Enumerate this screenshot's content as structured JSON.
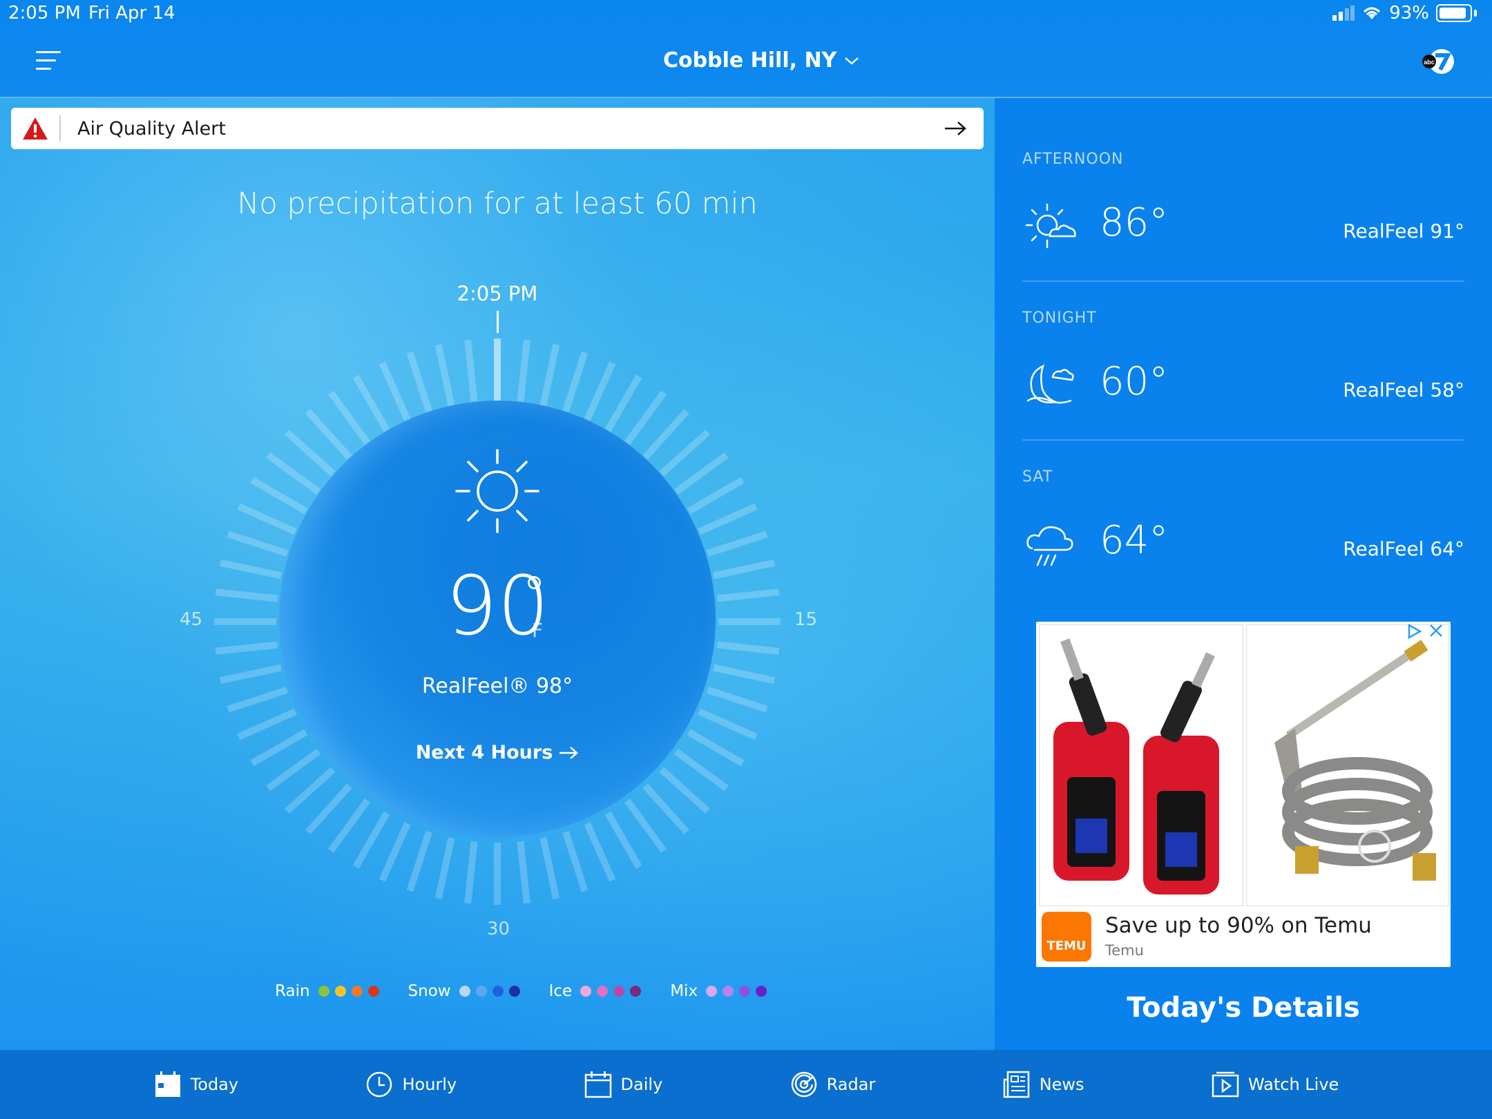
{
  "status_bar": {
    "time": "2:05 PM",
    "date": "Fri Apr 14",
    "battery": "93%"
  },
  "header": {
    "location": "Cobble Hill, NY"
  },
  "alert": {
    "text": "Air Quality Alert"
  },
  "minutecast": {
    "summary": "No precipitation for at least 60 min",
    "time": "2:05 PM",
    "dial_labels": {
      "left": "45",
      "right": "15",
      "bottom": "30"
    }
  },
  "current": {
    "temperature": "90",
    "degree": "°",
    "unit": "F",
    "realfeel": "RealFeel® 98°",
    "next_hours": "Next 4 Hours",
    "icon": "sun-icon"
  },
  "legend": [
    {
      "label": "Rain",
      "colors": [
        "#8ac43f",
        "#f2c62b",
        "#f07a2a",
        "#d9361e"
      ]
    },
    {
      "label": "Snow",
      "colors": [
        "#b8d8f5",
        "#5aa8f0",
        "#2060e0",
        "#1a2fa8"
      ]
    },
    {
      "label": "Ice",
      "colors": [
        "#f2a8d8",
        "#e070c0",
        "#b84aa8",
        "#7a2a78"
      ]
    },
    {
      "label": "Mix",
      "colors": [
        "#d8a8f0",
        "#b880f0",
        "#9050e0",
        "#6a20c8"
      ]
    }
  ],
  "forecast": [
    {
      "label": "AFTERNOON",
      "temp": "86°",
      "realfeel": "RealFeel 91°",
      "icon": "partly-sunny-icon"
    },
    {
      "label": "TONIGHT",
      "temp": "60°",
      "realfeel": "RealFeel 58°",
      "icon": "moon-cloud-icon"
    },
    {
      "label": "SAT",
      "temp": "64°",
      "realfeel": "RealFeel 64°",
      "icon": "rain-cloud-icon"
    }
  ],
  "ad": {
    "title": "Save up to 90% on Temu",
    "brand": "Temu",
    "logo_text": "TEMU"
  },
  "details_title": "Today's Details",
  "nav": [
    "Today",
    "Hourly",
    "Daily",
    "Radar",
    "News",
    "Watch Live"
  ]
}
